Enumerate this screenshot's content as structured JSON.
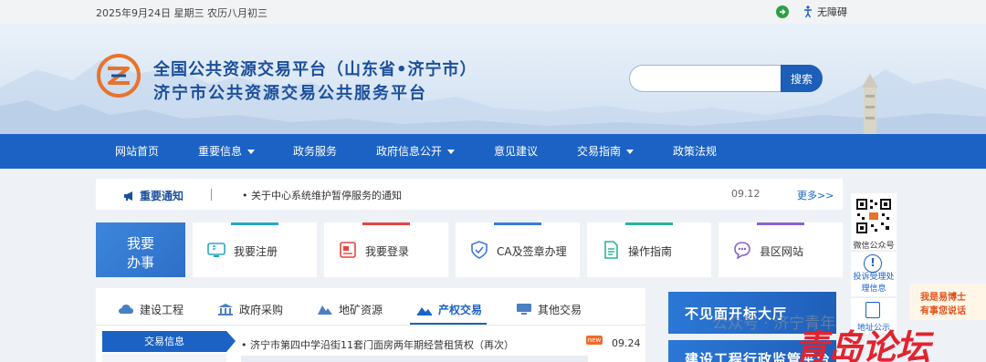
{
  "topbar": {
    "date": "2025年9月24日 星期三 农历八月初三",
    "accessibility_label": "无障碍"
  },
  "header": {
    "title_line1": "全国公共资源交易平台（山东省•济宁市）",
    "title_line2": "济宁市公共资源交易公共服务平台",
    "search_placeholder": "",
    "search_button": "搜索"
  },
  "nav": {
    "items": [
      {
        "label": "网站首页"
      },
      {
        "label": "重要信息"
      },
      {
        "label": "政务服务"
      },
      {
        "label": "政府信息公开"
      },
      {
        "label": "意见建议"
      },
      {
        "label": "交易指南"
      },
      {
        "label": "政策法规"
      }
    ]
  },
  "notice": {
    "label": "重要通知",
    "text": "• 关于中心系统维护暂停服务的通知",
    "date": "09.12",
    "more": "更多>>"
  },
  "sidebar": {
    "wechat_label": "微信公众号",
    "complaint_label_line1": "投诉受理处",
    "complaint_label_line2": "理信息",
    "info_label": "地址公示"
  },
  "promo": {
    "line1": "我是易博士",
    "line2": "有事您说话"
  },
  "services": {
    "banner_line1": "我要",
    "banner_line2": "办事",
    "items": [
      {
        "label": "我要注册",
        "accent": "#2aa6c9"
      },
      {
        "label": "我要登录",
        "accent": "#e5453f"
      },
      {
        "label": "CA及签章办理",
        "accent": "#3a7be0"
      },
      {
        "label": "操作指南",
        "accent": "#2bb39b"
      },
      {
        "label": "县区网站",
        "accent": "#8a63d2"
      }
    ]
  },
  "tabs": {
    "items": [
      {
        "label": "建设工程"
      },
      {
        "label": "政府采购"
      },
      {
        "label": "地矿资源"
      },
      {
        "label": "产权交易"
      },
      {
        "label": "其他交易"
      }
    ],
    "active_index": 3
  },
  "listing": {
    "category": "交易信息",
    "rows": [
      {
        "title": "• 济宁市第四中学沿街11套门面房两年期经营租赁权（再次）",
        "badge": "new",
        "date": "09.24"
      }
    ]
  },
  "right_banners": {
    "banner1": "不见面开标大厅",
    "banner2": "建设工程行政监管平台"
  },
  "watermark": {
    "text1": "公众号 · 济宁青年",
    "text2": "青岛论坛"
  },
  "colors": {
    "primary": "#1b62c4",
    "title_blue": "#1b4f9c",
    "accent_orange": "#f26b2b"
  }
}
